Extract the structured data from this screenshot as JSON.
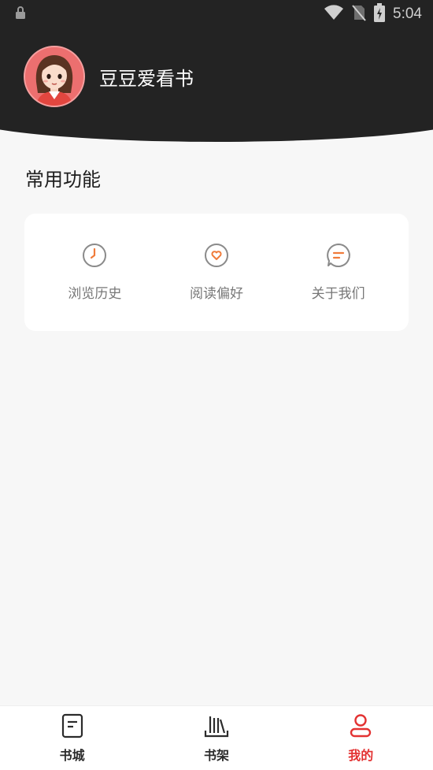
{
  "status_bar": {
    "time": "5:04",
    "icons": [
      "lock-icon",
      "wifi-icon",
      "no-sim-icon",
      "battery-charging-icon"
    ]
  },
  "profile": {
    "username": "豆豆爱看书",
    "avatar_icon": "girl-avatar"
  },
  "common_functions": {
    "title": "常用功能",
    "items": [
      {
        "label": "浏览历史",
        "icon": "clock-icon"
      },
      {
        "label": "阅读偏好",
        "icon": "heart-icon"
      },
      {
        "label": "关于我们",
        "icon": "chat-bubble-icon"
      }
    ]
  },
  "bottom_nav": {
    "items": [
      {
        "label": "书城",
        "icon": "book-icon",
        "active": false
      },
      {
        "label": "书架",
        "icon": "bookshelf-icon",
        "active": false
      },
      {
        "label": "我的",
        "icon": "user-icon",
        "active": true
      }
    ]
  },
  "colors": {
    "header_bg": "#232323",
    "accent": "#e33232",
    "icon_accent": "#f07b3a",
    "page_bg": "#f7f7f7"
  }
}
